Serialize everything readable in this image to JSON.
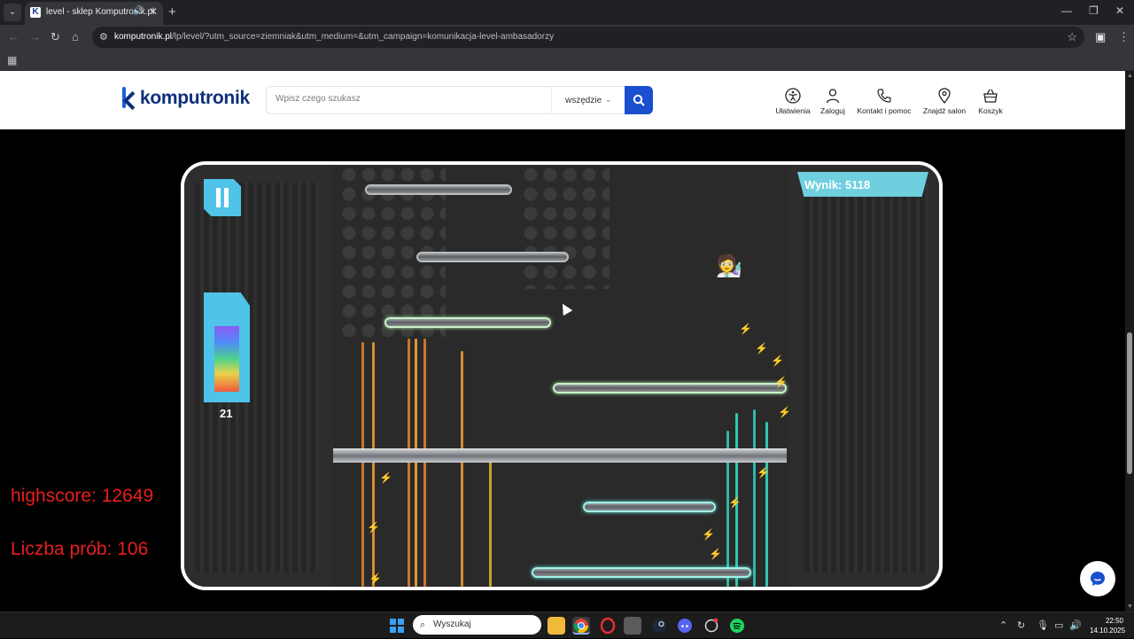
{
  "browser": {
    "tab_title": "level - sklep Komputronik.pl",
    "url_host": "komputronik.pl",
    "url_path": "/lp/level/?utm_source=ziemniak&utm_medium=&utm_campaign=komunikacja-level-ambasadorzy"
  },
  "header": {
    "logo_text": "komputronik",
    "search_placeholder": "Wpisz czego szukasz",
    "search_scope": "wszędzie",
    "actions": [
      {
        "label": "Ułatwienia",
        "icon": "accessibility-icon"
      },
      {
        "label": "Zaloguj",
        "icon": "user-icon"
      },
      {
        "label": "Kontakt i pomoc",
        "icon": "phone-icon"
      },
      {
        "label": "Znajdź salon",
        "icon": "location-pin-icon"
      },
      {
        "label": "Koszyk",
        "icon": "basket-icon"
      }
    ]
  },
  "game": {
    "score_label": "Wynik: 5118",
    "power_count": "21",
    "power_level": 0.86
  },
  "stats": {
    "highscore": "highscore: 12649",
    "attempts": "Liczba prób: 106"
  },
  "taskbar": {
    "search_label": "Wyszukaj",
    "time": "22:50",
    "date": "14.10.2025"
  },
  "colors": {
    "brand_blue": "#1a4fcf",
    "stat_red": "#e81e1e",
    "hud_cyan": "#4fc3e8"
  }
}
